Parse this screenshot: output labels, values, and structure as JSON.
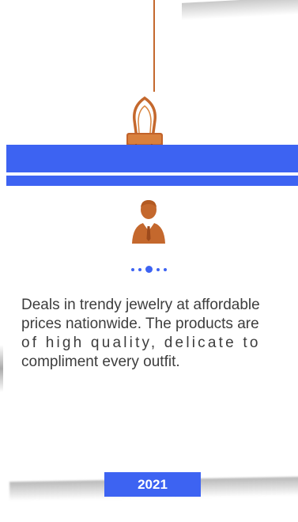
{
  "card": {
    "description_lines": [
      "Deals in trendy jewelry at affordable",
      "prices nationwide. The products are",
      "of high quality, delicate to",
      "compliment every outfit."
    ],
    "year": "2021"
  },
  "pager": {
    "count": 5,
    "active_index": 2
  },
  "icons": {
    "clip": "binder-clip-icon",
    "person": "businessman-icon"
  },
  "colors": {
    "accent": "#3d63f2",
    "copper": "#c4682d",
    "text": "#3d3d3d"
  }
}
